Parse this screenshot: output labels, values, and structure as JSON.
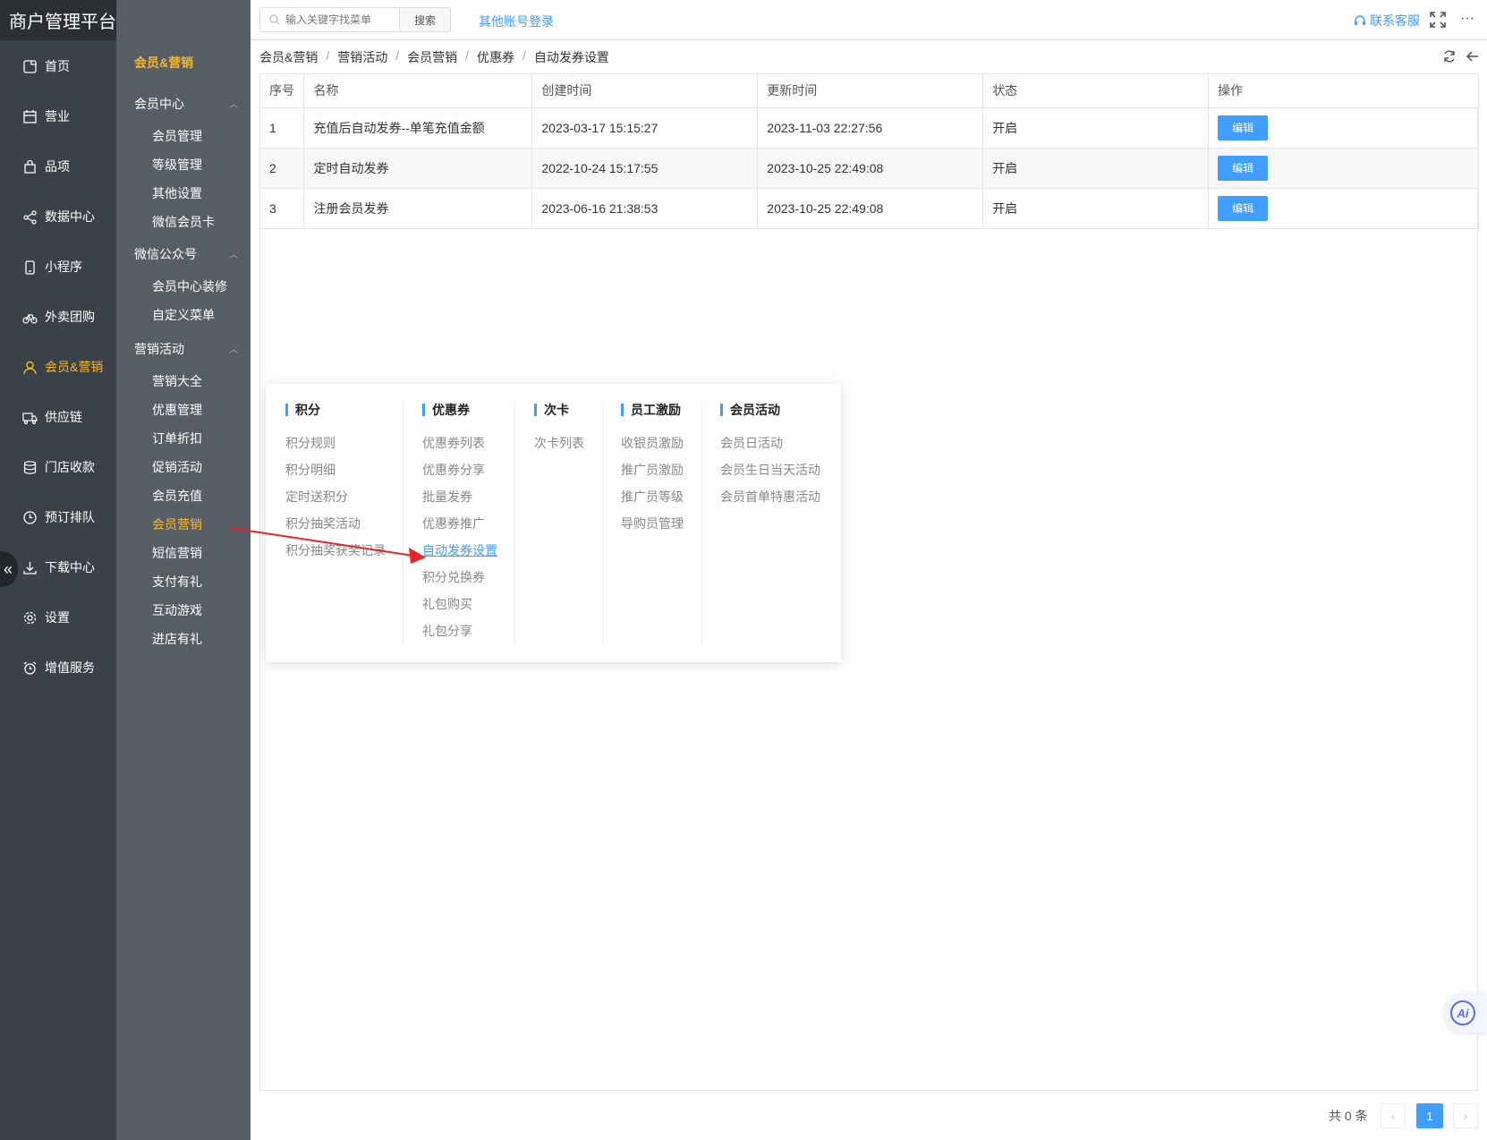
{
  "brand": "商户管理平台",
  "nav": [
    {
      "label": "首页",
      "icon": "home-icon"
    },
    {
      "label": "营业",
      "icon": "calendar-icon"
    },
    {
      "label": "品项",
      "icon": "bag-icon"
    },
    {
      "label": "数据中心",
      "icon": "share-icon"
    },
    {
      "label": "小程序",
      "icon": "phone-icon"
    },
    {
      "label": "外卖团购",
      "icon": "bike-icon"
    },
    {
      "label": "会员&营销",
      "icon": "user-icon"
    },
    {
      "label": "供应链",
      "icon": "truck-icon"
    },
    {
      "label": "门店收款",
      "icon": "coins-icon"
    },
    {
      "label": "预订排队",
      "icon": "clock-icon"
    },
    {
      "label": "下载中心",
      "icon": "download-icon"
    },
    {
      "label": "设置",
      "icon": "gear-icon"
    },
    {
      "label": "增值服务",
      "icon": "alarm-icon"
    }
  ],
  "subnav": {
    "title": "会员&营销",
    "groups": [
      {
        "label": "会员中心",
        "items": [
          "会员管理",
          "等级管理",
          "其他设置",
          "微信会员卡"
        ]
      },
      {
        "label": "微信公众号",
        "items": [
          "会员中心装修",
          "自定义菜单"
        ]
      },
      {
        "label": "营销活动",
        "items": [
          "营销大全",
          "优惠管理",
          "订单折扣",
          "促销活动",
          "会员充值",
          "会员营销",
          "短信营销",
          "支付有礼",
          "互动游戏",
          "进店有礼"
        ]
      }
    ]
  },
  "topbar": {
    "search_placeholder": "输入关键字找菜单",
    "search_btn": "搜索",
    "other_login": "其他账号登录",
    "contact": "联系客服",
    "more": "···"
  },
  "breadcrumb": [
    "会员&营销",
    "营销活动",
    "会员营销",
    "优惠券",
    "自动发券设置"
  ],
  "table": {
    "headers": [
      "序号",
      "名称",
      "创建时间",
      "更新时间",
      "状态",
      "操作"
    ],
    "rows": [
      {
        "no": "1",
        "name": "充值后自动发券--单笔充值金额",
        "created": "2023-03-17 15:15:27",
        "updated": "2023-11-03 22:27:56",
        "status": "开启",
        "action": "编辑"
      },
      {
        "no": "2",
        "name": "定时自动发券",
        "created": "2022-10-24 15:17:55",
        "updated": "2023-10-25 22:49:08",
        "status": "开启",
        "action": "编辑"
      },
      {
        "no": "3",
        "name": "注册会员发券",
        "created": "2023-06-16 21:38:53",
        "updated": "2023-10-25 22:49:08",
        "status": "开启",
        "action": "编辑"
      }
    ]
  },
  "mega_menu": [
    {
      "title": "积分",
      "items": [
        "积分规则",
        "积分明细",
        "定时送积分",
        "积分抽奖活动",
        "积分抽奖获奖记录"
      ]
    },
    {
      "title": "优惠券",
      "items": [
        "优惠券列表",
        "优惠券分享",
        "批量发券",
        "优惠券推广",
        "自动发券设置",
        "积分兑换券",
        "礼包购买",
        "礼包分享"
      ]
    },
    {
      "title": "次卡",
      "items": [
        "次卡列表"
      ]
    },
    {
      "title": "员工激励",
      "items": [
        "收银员激励",
        "推广员激励",
        "推广员等级",
        "导购员管理"
      ]
    },
    {
      "title": "会员活动",
      "items": [
        "会员日活动",
        "会员生日当天活动",
        "会员首单特惠活动"
      ]
    }
  ],
  "pagination": {
    "total": "共 0 条",
    "current": "1"
  },
  "ai_label": "Ai",
  "colors": {
    "accent": "#409eff",
    "active": "#f5b930",
    "sidebar": "#3a4148",
    "subsidebar": "#575e65",
    "arrow": "#e8262a"
  }
}
